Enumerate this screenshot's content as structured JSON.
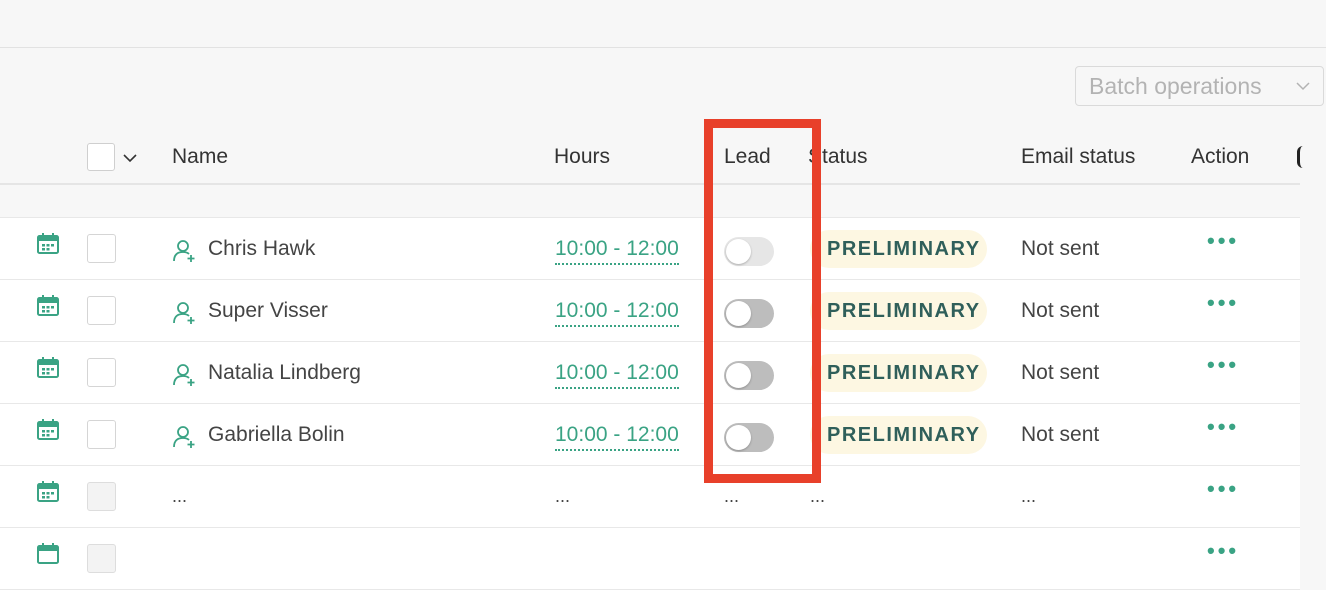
{
  "toolbar": {
    "batch_label": "Batch operations"
  },
  "table": {
    "headers": {
      "name": "Name",
      "hours": "Hours",
      "lead": "Lead",
      "status": "Status",
      "email_status": "Email status",
      "action": "Action"
    },
    "rows": [
      {
        "name": "Chris Hawk",
        "hours": "10:00 - 12:00",
        "lead": false,
        "status": "PRELIMINARY",
        "email_status": "Not sent",
        "action": "•••"
      },
      {
        "name": "Super Visser",
        "hours": "10:00 - 12:00",
        "lead": false,
        "status": "PRELIMINARY",
        "email_status": "Not sent",
        "action": "•••"
      },
      {
        "name": "Natalia Lindberg",
        "hours": "10:00 - 12:00",
        "lead": false,
        "status": "PRELIMINARY",
        "email_status": "Not sent",
        "action": "•••"
      },
      {
        "name": "Gabriella Bolin",
        "hours": "10:00 - 12:00",
        "lead": false,
        "status": "PRELIMINARY",
        "email_status": "Not sent",
        "action": "•••"
      }
    ],
    "placeholder_row": {
      "name": "...",
      "hours": "...",
      "lead": "...",
      "status": "...",
      "email_status": "...",
      "action": "•••"
    },
    "last_row": {
      "action": "•••"
    }
  },
  "colors": {
    "accent": "#3aa384",
    "status_bg": "#fdf7e2",
    "status_text": "#2f5f5a",
    "highlight": "#e8402a"
  },
  "icons": {
    "calendar": "calendar-icon",
    "person": "person-add-icon",
    "chevron": "chevron-down-icon"
  }
}
